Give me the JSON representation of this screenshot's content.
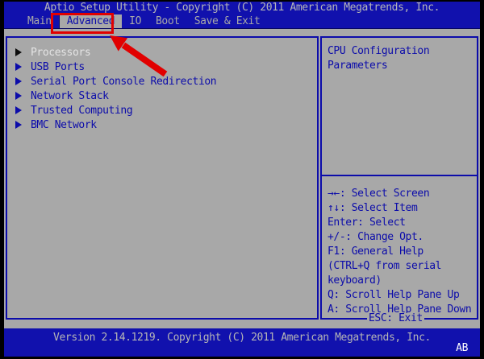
{
  "title_bar": {
    "text": "Aptio Setup Utility - Copyright (C) 2011 American Megatrends, Inc."
  },
  "menu": {
    "items": [
      {
        "label": "Main",
        "selected": false
      },
      {
        "label": "Advanced",
        "selected": true
      },
      {
        "label": "IO",
        "selected": false
      },
      {
        "label": "Boot",
        "selected": false
      },
      {
        "label": "Save & Exit",
        "selected": false
      }
    ]
  },
  "left_panel": {
    "items": [
      {
        "label": "Processors",
        "selected": true
      },
      {
        "label": "USB Ports",
        "selected": false
      },
      {
        "label": "Serial Port Console Redirection",
        "selected": false
      },
      {
        "label": "Network Stack",
        "selected": false
      },
      {
        "label": "Trusted Computing",
        "selected": false
      },
      {
        "label": "BMC Network",
        "selected": false
      }
    ]
  },
  "right_panel": {
    "description_lines": [
      "CPU Configuration",
      "Parameters"
    ],
    "help_keys": [
      "→←: Select Screen",
      "↑↓: Select Item",
      "Enter: Select",
      "+/-: Change Opt.",
      "F1: General Help",
      "(CTRL+Q from serial",
      "keyboard)",
      "Q: Scroll Help Pane Up",
      "A: Scroll Help Pane Down"
    ],
    "exit_key": "ESC: Exit"
  },
  "status_bar": {
    "version_text": "Version 2.14.1219. Copyright (C) 2011 American Megatrends, Inc.",
    "corner_label": "AB"
  },
  "annotation": {
    "target": "Advanced tab",
    "shapes": [
      "highlight-box",
      "arrow"
    ]
  },
  "colors": {
    "background_blue": "#1111ad",
    "panel_gray": "#a8a8a8",
    "text_blue": "#0c0caa",
    "muted_text": "#b6b6b6",
    "selected_item_text": "#e4e4e4",
    "corner_text": "#ffffff",
    "annotation_red": "#e10000"
  }
}
